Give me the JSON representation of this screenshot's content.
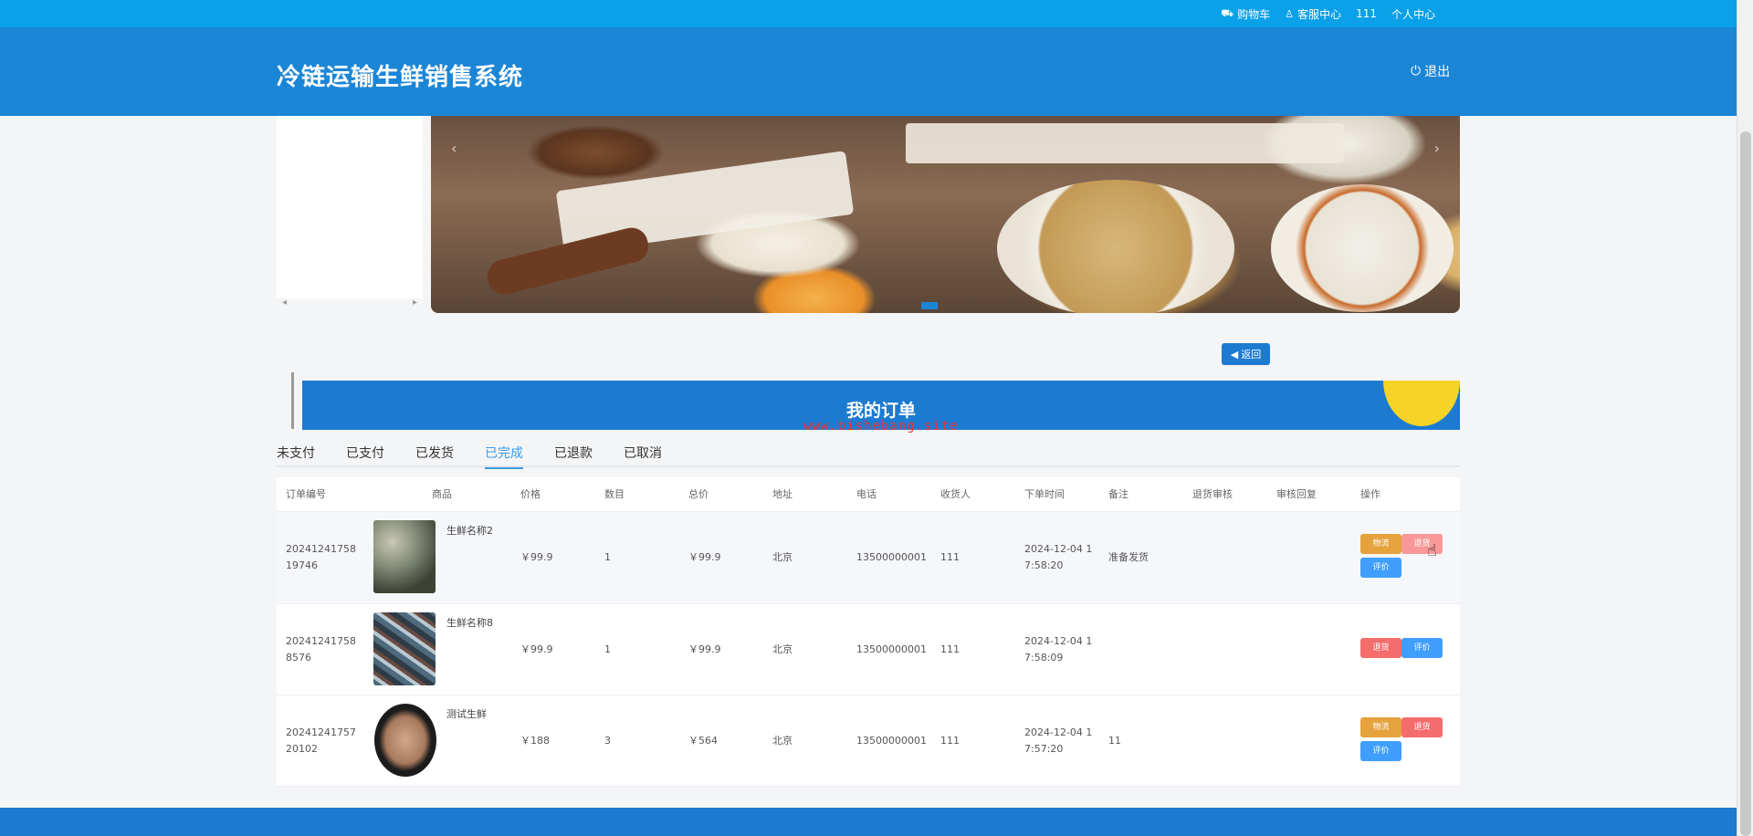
{
  "topbar": {
    "cart": "购物车",
    "service": "客服中心",
    "username": "111",
    "profile": "个人中心"
  },
  "header": {
    "title": "冷链运输生鲜销售系统",
    "logout": "退出"
  },
  "banner": {
    "prev_arrow": "‹",
    "next_arrow": "›"
  },
  "side_nav": {
    "prev": "◂",
    "next": "▸"
  },
  "back_button": "返回",
  "orders_title": "我的订单",
  "watermark": "www.bishebang.site",
  "tabs": [
    "未支付",
    "已支付",
    "已发货",
    "已完成",
    "已退款",
    "已取消"
  ],
  "active_tab": "已完成",
  "table": {
    "headers": {
      "order_no": "订单编号",
      "goods": "商品",
      "price": "价格",
      "qty": "数目",
      "total": "总价",
      "address": "地址",
      "phone": "电话",
      "receiver": "收货人",
      "time": "下单时间",
      "note": "备注",
      "refund_review": "退货审核",
      "review_reply": "审核回复",
      "action": "操作"
    },
    "rows": [
      {
        "order_no": "20241241758 19746",
        "goods_name": "生鲜名称2",
        "price": "￥99.9",
        "qty": "1",
        "total": "￥99.9",
        "address": "北京",
        "phone": "13500000001",
        "receiver": "111",
        "time": "2024-12-04 1 7:58:20",
        "note": "准备发货",
        "refund_review": "",
        "review_reply": "",
        "buttons": [
          "物流",
          "退货",
          "评价"
        ]
      },
      {
        "order_no": "20241241758 8576",
        "goods_name": "生鲜名称8",
        "price": "￥99.9",
        "qty": "1",
        "total": "￥99.9",
        "address": "北京",
        "phone": "13500000001",
        "receiver": "111",
        "time": "2024-12-04 1 7:58:09",
        "note": "",
        "refund_review": "",
        "review_reply": "",
        "buttons": [
          "退货",
          "评价"
        ]
      },
      {
        "order_no": "20241241757 20102",
        "goods_name": "测试生鲜",
        "price": "￥188",
        "qty": "3",
        "total": "￥564",
        "address": "北京",
        "phone": "13500000001",
        "receiver": "111",
        "time": "2024-12-04 1 7:57:20",
        "note": "11",
        "refund_review": "",
        "review_reply": "",
        "buttons": [
          "物流",
          "退货",
          "评价"
        ]
      }
    ]
  },
  "colors": {
    "topbar": "#0aa1e8",
    "header": "#1c86d6",
    "accent": "#1c7ad1",
    "tab_active": "#3a9be8",
    "btn_orange": "#e6a23c",
    "btn_red": "#f56c6c",
    "btn_blue": "#409eff"
  }
}
